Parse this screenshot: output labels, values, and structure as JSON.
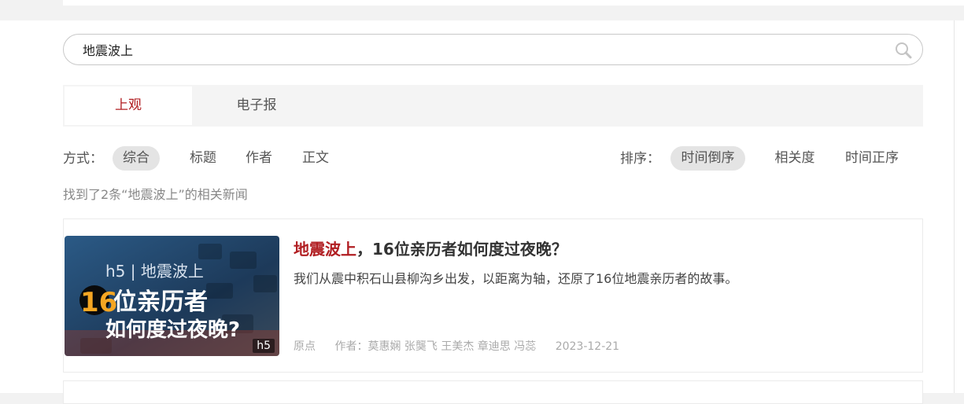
{
  "search": {
    "value": "地震波上",
    "placeholder": ""
  },
  "tabs": [
    {
      "label": "上观",
      "active": true
    },
    {
      "label": "电子报",
      "active": false
    }
  ],
  "filter": {
    "mode_label": "方式：",
    "modes": [
      "综合",
      "标题",
      "作者",
      "正文"
    ],
    "mode_selected": "综合",
    "sort_label": "排序：",
    "sorts": [
      "时间倒序",
      "相关度",
      "时间正序"
    ],
    "sort_selected": "时间倒序"
  },
  "result_count": "找到了2条“地震波上”的相关新闻",
  "results": [
    {
      "title_highlight": "地震波上",
      "title_rest": "，16位亲历者如何度过夜晚？",
      "summary": "我们从震中积石山县柳沟乡出发，以距离为轴，还原了16位地震亲历者的故事。",
      "source": "原点",
      "authors": "作者：莫惠娴 张龑飞 王美杰 章迪思 冯蕊",
      "date": "2023-12-21",
      "thumb": {
        "line1": "h5 | 地震波上",
        "big_num": "16",
        "line2": "位亲历者",
        "line3": "如何度过夜晚?",
        "badge": "h5"
      }
    }
  ],
  "colors": {
    "accent": "#b11e22",
    "chip_bg": "#e4e4e4",
    "tab_bg": "#f4f4f4"
  }
}
